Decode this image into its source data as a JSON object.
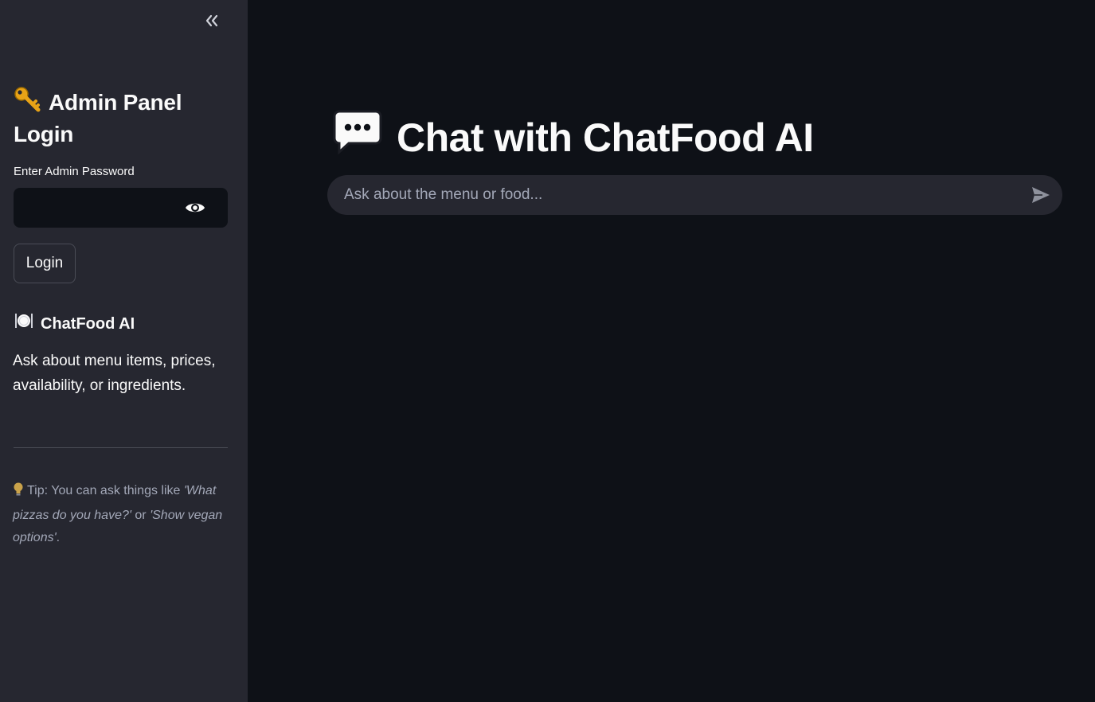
{
  "sidebar": {
    "title": "Admin Panel Login",
    "password_label": "Enter Admin Password",
    "password_value": "",
    "login_label": "Login",
    "brand_name": "ChatFood AI",
    "description": "Ask about menu items, prices, availability, or ingredients.",
    "tip": {
      "prefix": "Tip: You can ask things like ",
      "example1": "'What pizzas do you have?'",
      "middle": " or ",
      "example2": "'Show vegan options'",
      "suffix": "."
    },
    "icons": {
      "collapse": "double-chevron-left-icon",
      "title": "key-icon",
      "password_toggle": "eye-icon",
      "brand": "plate-with-cutlery-icon",
      "tip": "lightbulb-icon"
    }
  },
  "main": {
    "title": "Chat with ChatFood AI",
    "chat_placeholder": "Ask about the menu or food...",
    "icons": {
      "title": "speech-bubble-icon",
      "send": "send-icon"
    }
  },
  "colors": {
    "background": "#0e1117",
    "sidebar": "#262730",
    "text": "#fafafa",
    "muted_text": "#a3a8b8"
  }
}
